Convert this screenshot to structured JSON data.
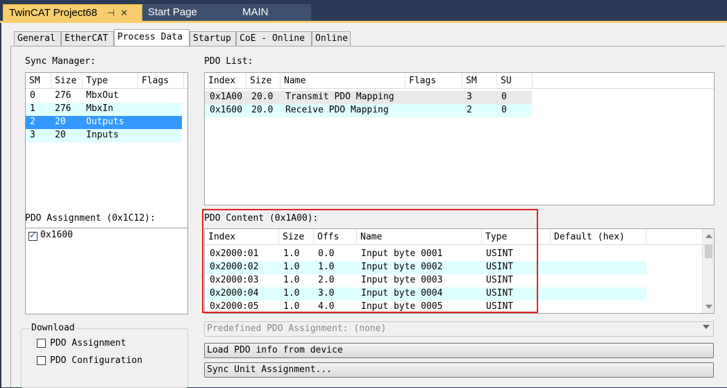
{
  "doc_tabs": [
    {
      "label": "TwinCAT Project68"
    },
    {
      "label": "Start Page"
    },
    {
      "label": "MAIN"
    }
  ],
  "prop_tabs": [
    "General",
    "EtherCAT",
    "Process Data",
    "Startup",
    "CoE - Online",
    "Online"
  ],
  "sync_manager": {
    "label": "Sync Manager:",
    "columns": [
      "SM",
      "Size",
      "Type",
      "Flags"
    ],
    "rows": [
      {
        "sm": "0",
        "size": "276",
        "type": "MbxOut",
        "flags": ""
      },
      {
        "sm": "1",
        "size": "276",
        "type": "MbxIn",
        "flags": ""
      },
      {
        "sm": "2",
        "size": "20",
        "type": "Outputs",
        "flags": ""
      },
      {
        "sm": "3",
        "size": "20",
        "type": "Inputs",
        "flags": ""
      }
    ]
  },
  "pdo_list": {
    "label": "PDO List:",
    "columns": [
      "Index",
      "Size",
      "Name",
      "Flags",
      "SM",
      "SU"
    ],
    "rows": [
      {
        "index": "0x1A00",
        "size": "20.0",
        "name": "Transmit PDO Mapping",
        "flags": "",
        "sm": "3",
        "su": "0"
      },
      {
        "index": "0x1600",
        "size": "20.0",
        "name": "Receive PDO Mapping",
        "flags": "",
        "sm": "2",
        "su": "0"
      }
    ]
  },
  "pdo_assignment": {
    "label": "PDO Assignment (0x1C12):",
    "items": [
      {
        "label": "0x1600",
        "checked": true
      }
    ]
  },
  "pdo_content": {
    "label": "PDO Content (0x1A00):",
    "columns": [
      "Index",
      "Size",
      "Offs",
      "Name",
      "Type",
      "Default (hex)"
    ],
    "rows": [
      {
        "index": "0x2000:01",
        "size": "1.0",
        "offs": "0.0",
        "name": "Input byte 0001",
        "type": "USINT",
        "default": ""
      },
      {
        "index": "0x2000:02",
        "size": "1.0",
        "offs": "1.0",
        "name": "Input byte 0002",
        "type": "USINT",
        "default": ""
      },
      {
        "index": "0x2000:03",
        "size": "1.0",
        "offs": "2.0",
        "name": "Input byte 0003",
        "type": "USINT",
        "default": ""
      },
      {
        "index": "0x2000:04",
        "size": "1.0",
        "offs": "3.0",
        "name": "Input byte 0004",
        "type": "USINT",
        "default": ""
      },
      {
        "index": "0x2000:05",
        "size": "1.0",
        "offs": "4.0",
        "name": "Input byte 0005",
        "type": "USINT",
        "default": ""
      }
    ]
  },
  "download": {
    "label": "Download",
    "pdo_assignment": "PDO Assignment",
    "pdo_configuration": "PDO Configuration"
  },
  "predefined": {
    "value": "Predefined PDO Assignment: (none)"
  },
  "buttons": {
    "load_pdo": "Load PDO info from device",
    "sync_unit": "Sync Unit Assignment..."
  },
  "colors": {
    "accent_tab": "#f7ce6b",
    "selection": "#3399ff",
    "alt_row": "#e0ffff",
    "highlight_box": "#e02020"
  }
}
